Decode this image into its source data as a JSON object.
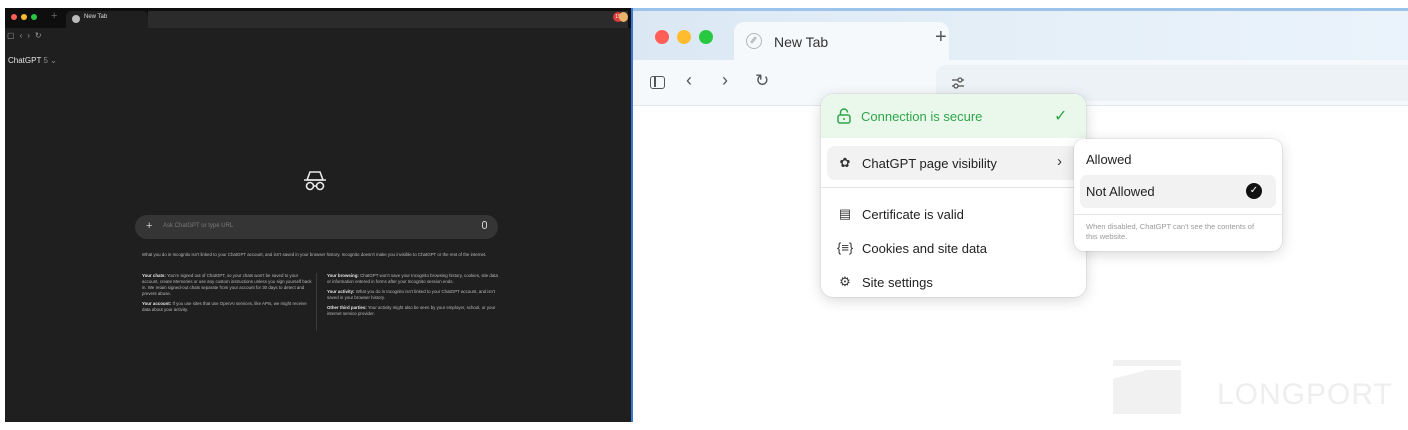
{
  "left_window": {
    "tab_title": "New Tab",
    "profile_badge": "19",
    "model_name": "ChatGPT",
    "model_version": "5",
    "input_placeholder": "Ask ChatGPT or type URL",
    "intro_text": "What you do in Incognito isn't linked to your ChatGPT account, and isn't saved in your browser history. Incognito doesn't make you invisible to ChatGPT or the rest of the internet.",
    "left_column": [
      {
        "heading": "Your chats:",
        "text": "You're signed out of ChatGPT, so your chats won't be saved to your account, create Memories or use any custom instructions unless you sign yourself back in. We retain signed-out chats separate from your account for 30 days to detect and prevent abuse."
      },
      {
        "heading": "Your account:",
        "text": "If you use sites that use OpenAI services, like APIs, we might receive data about your activity."
      }
    ],
    "right_column": [
      {
        "heading": "Your browsing:",
        "text": "ChatGPT won't save your Incognito browsing history, cookies, site data or information entered in forms after your Incognito session ends."
      },
      {
        "heading": "Your activity:",
        "text": "What you do in Incognito isn't linked to your ChatGPT account, and isn't saved in your browser history."
      },
      {
        "heading": "Other third parties:",
        "text": "Your activity might also be seen by your employer, school, or your internet service provider."
      }
    ]
  },
  "right_window": {
    "tab_title": "New Tab",
    "new_tab_symbol": "+",
    "popup": {
      "secure_label": "Connection is secure",
      "items": [
        {
          "label": "ChatGPT page visibility",
          "icon": "openai-icon"
        },
        {
          "label": "Certificate is valid",
          "icon": "certificate-icon"
        },
        {
          "label": "Cookies and site data",
          "icon": "cookies-icon"
        },
        {
          "label": "Site settings",
          "icon": "gear-icon"
        }
      ]
    },
    "submenu": {
      "options": [
        "Allowed",
        "Not Allowed"
      ],
      "selected": "Not Allowed",
      "note": "When disabled, ChatGPT can't see the contents of this website."
    },
    "watermark": "LONGPORT"
  },
  "colors": {
    "secure_green": "#2fa54a",
    "incognito_bg": "#1f1f1f",
    "accent_blue": "#3b77d6"
  }
}
